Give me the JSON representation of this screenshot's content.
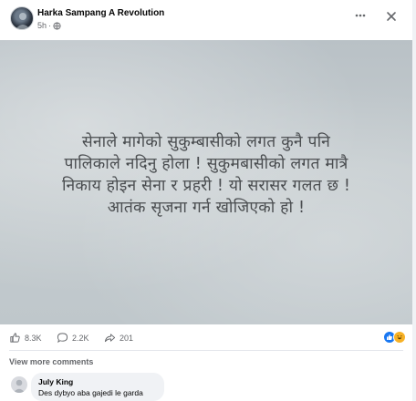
{
  "post": {
    "page_name": "Harka Sampang A Revolution",
    "time": "5h",
    "privacy_icon": "globe-icon",
    "image_text_lines": [
      "सेनाले मागेको सुकुम्बासीको लगत कुनै पनि",
      "पालिकाले नदिनु होला ! सुकुमबासीको लगत मात्रै",
      "निकाय होइन सेना र प्रहरी ! यो सरासर गलत छ !",
      "आतंक सृजना गर्न खोजिएको हो !"
    ]
  },
  "stats": {
    "likes": "8.3K",
    "comments": "2.2K",
    "shares": "201"
  },
  "comments_section": {
    "view_more_label": "View more comments",
    "items": [
      {
        "author": "July King",
        "text": "Des dybyo aba gajedi le garda"
      }
    ]
  },
  "colors": {
    "accent": "#1877f2",
    "secondary_text": "#65676b",
    "image_text": "#4a4d50"
  }
}
